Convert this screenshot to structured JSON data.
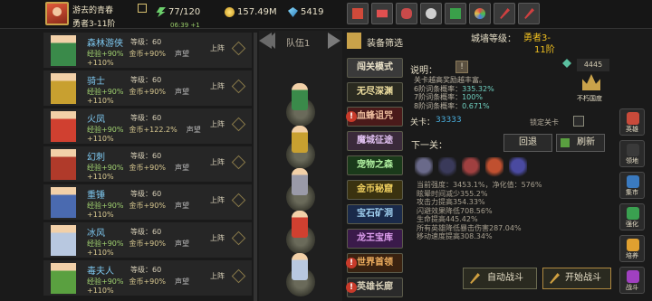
{
  "player": {
    "name": "游去的青春",
    "title": "勇者3-11阶",
    "timer": "06:39 +1",
    "energy": "77/120",
    "gold": "157.49M",
    "gems": "5419"
  },
  "menu_icons": [
    "shop-icon",
    "mail-icon",
    "gamepad-icon",
    "gear-icon",
    "gift-icon",
    "wheel-icon",
    "sword-icon",
    "sword-alt-icon"
  ],
  "heroes": [
    {
      "name": "森林游侠",
      "level": "等级：60",
      "exp": "经验+90%",
      "gold": "金币+90%",
      "fame": "声望",
      "bonus": "+110%",
      "action": "上阵",
      "color": "#3a8a4a"
    },
    {
      "name": "骑士",
      "level": "等级：60",
      "exp": "经验+90%",
      "gold": "金币+90%",
      "fame": "声望",
      "bonus": "+110%",
      "action": "上阵",
      "color": "#c8a030"
    },
    {
      "name": "火凤",
      "level": "等级：60",
      "exp": "经验+90%",
      "gold": "金币+122.2%",
      "fame": "声望",
      "bonus": "+110%",
      "action": "上阵",
      "color": "#d04030"
    },
    {
      "name": "幻刺",
      "level": "等级：60",
      "exp": "经验+90%",
      "gold": "金币+90%",
      "fame": "声望",
      "bonus": "+110%",
      "action": "上阵",
      "color": "#b03a2a"
    },
    {
      "name": "重锤",
      "level": "等级：60",
      "exp": "经验+90%",
      "gold": "金币+90%",
      "fame": "声望",
      "bonus": "+110%",
      "action": "上阵",
      "color": "#4a6ab0"
    },
    {
      "name": "冰风",
      "level": "等级：60",
      "exp": "经验+90%",
      "gold": "金币+90%",
      "fame": "声望",
      "bonus": "+110%",
      "action": "上阵",
      "color": "#b8c8e0"
    },
    {
      "name": "毒夫人",
      "level": "等级：60",
      "exp": "经验+90%",
      "gold": "金币+90%",
      "fame": "声望",
      "bonus": "+110%",
      "action": "上阵",
      "color": "#5aa040"
    }
  ],
  "team": {
    "label": "队伍1",
    "members": [
      "#3a8a4a",
      "#c8a030",
      "#9a9aa8",
      "#d04030",
      "#b8c8e0"
    ]
  },
  "equip_filter": {
    "title": "装备筛选"
  },
  "modes": [
    {
      "label": "闯关模式",
      "bg": "#3a3a3a",
      "fg": "#e8e0c8",
      "warn": false
    },
    {
      "label": "无尽深渊",
      "bg": "#2a2a20",
      "fg": "#f0e0a0",
      "warn": false
    },
    {
      "label": "血蜂诅咒",
      "bg": "#4a1a1a",
      "fg": "#f0c0a0",
      "warn": true
    },
    {
      "label": "魔城征途",
      "bg": "#3a2a3a",
      "fg": "#e0c0f0",
      "warn": false
    },
    {
      "label": "宠物之森",
      "bg": "#1a3a1a",
      "fg": "#b0f0a0",
      "warn": false
    },
    {
      "label": "金币秘窟",
      "bg": "#3a3210",
      "fg": "#f0d060",
      "warn": false
    },
    {
      "label": "宝石矿洞",
      "bg": "#1a2a4a",
      "fg": "#a0d0f0",
      "warn": false
    },
    {
      "label": "龙王宝库",
      "bg": "#3a1a4a",
      "fg": "#e0a0f0",
      "warn": false
    },
    {
      "label": "世界首领",
      "bg": "#3a2210",
      "fg": "#f0b060",
      "warn": true
    },
    {
      "label": "英雄长廊",
      "bg": "#2a2a2a",
      "fg": "#d8d0b8",
      "warn": true
    }
  ],
  "city": {
    "label": "城墙等级：",
    "value_line1": "勇者3-",
    "value_line2": "11阶"
  },
  "info": {
    "desc_label": "说明：",
    "desc_badge": "!",
    "key_count": "4445",
    "desc_lines": [
      {
        "text": "关卡越高奖励越丰富。",
        "value": ""
      },
      {
        "text": "6阶词条概率：",
        "value": "335.32%"
      },
      {
        "text": "7阶词条概率：",
        "value": "100%"
      },
      {
        "text": "8阶词条概率：",
        "value": "0.671%"
      }
    ],
    "crown_label": "不朽国度",
    "stage_label": "关卡：",
    "stage_value": "33333",
    "lock_label": "锁定关卡"
  },
  "next": {
    "label": "下一关：",
    "retreat": "回退",
    "refresh": "刷新",
    "enemies": [
      "#6a6a8a",
      "#3a3a5a",
      "#a04040",
      "#c05030",
      "#4a4aa0"
    ],
    "stats": [
      "当前强度：3453.1%，净化值：576%",
      "眩晕时间减少355.2%",
      "攻击力提高354.33%",
      "闪避效果降低708.56%",
      "生命提高445.42%",
      "所有英雄降低暴击伤害287.04%",
      "移动速度提高308.34%"
    ]
  },
  "actions": {
    "auto": "自动战斗",
    "start": "开始战斗"
  },
  "sidebar": [
    {
      "label": "英雄",
      "color": "#c84a3a"
    },
    {
      "label": "领地",
      "color": "#3a3a3a"
    },
    {
      "label": "集市",
      "color": "#3a7ac0"
    },
    {
      "label": "强化",
      "color": "#3aa050"
    },
    {
      "label": "培养",
      "color": "#e0a030"
    },
    {
      "label": "战斗",
      "color": "#a040c0"
    }
  ]
}
